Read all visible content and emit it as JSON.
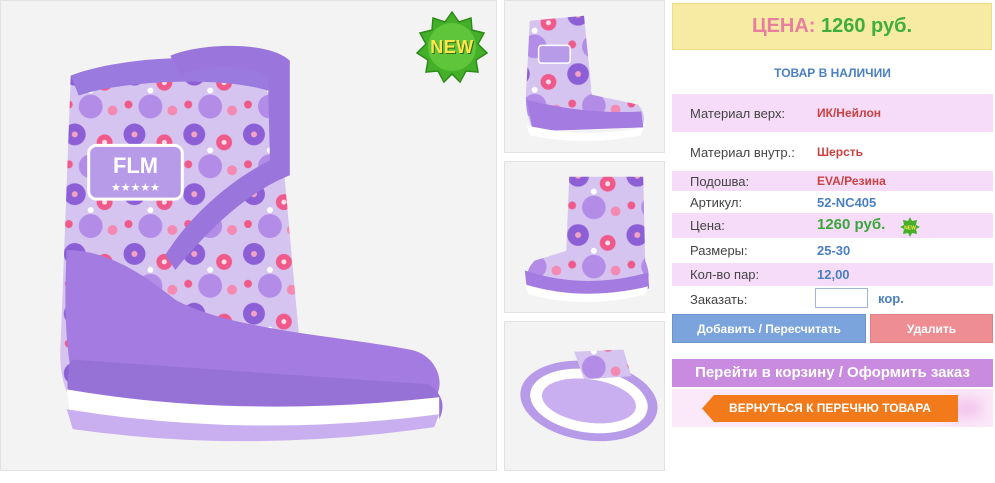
{
  "badge": {
    "text": "NEW",
    "mini_text": "NEW"
  },
  "images": {
    "main": "boot-side-view-image",
    "thumb1": "boot-side-thumbnail",
    "thumb2": "boot-angle-thumbnail",
    "thumb3": "boot-sole-thumbnail",
    "brand_text": "FLM"
  },
  "price_box": {
    "label": "ЦЕНА:",
    "value": "1260 руб."
  },
  "stock_status": "ТОВАР В НАЛИЧИИ",
  "specs": {
    "upper": {
      "label": "Материал верх:",
      "value": "ИК/Нейлон"
    },
    "lining": {
      "label": "Материал внутр.:",
      "value": "Шерсть"
    },
    "sole": {
      "label": "Подошва:",
      "value": "EVA/Резина"
    },
    "article": {
      "label": "Артикул:",
      "value": "52-NC405"
    },
    "price": {
      "label": "Цена:",
      "value": "1260 руб."
    },
    "sizes": {
      "label": "Размеры:",
      "value": "25-30"
    },
    "pairs": {
      "label": "Кол-во пар:",
      "value": "12,00"
    },
    "order": {
      "label": "Заказать:",
      "value": "",
      "unit": "кор."
    }
  },
  "buttons": {
    "add": "Добавить / Пересчитать",
    "delete": "Удалить",
    "cart": "Перейти в корзину / Оформить заказ",
    "back": "ВЕРНУТЬСЯ К ПЕРЕЧНЮ ТОВАРА"
  },
  "colors": {
    "price_label": "#e77f9f",
    "price_value": "#3fae3f",
    "accent_blue": "#4a80c0",
    "row_pink": "#f6dcf9",
    "button_blue": "#7ba3dc",
    "button_red": "#ee8e93",
    "button_purple": "#c98be0",
    "button_orange": "#f27a1a"
  }
}
